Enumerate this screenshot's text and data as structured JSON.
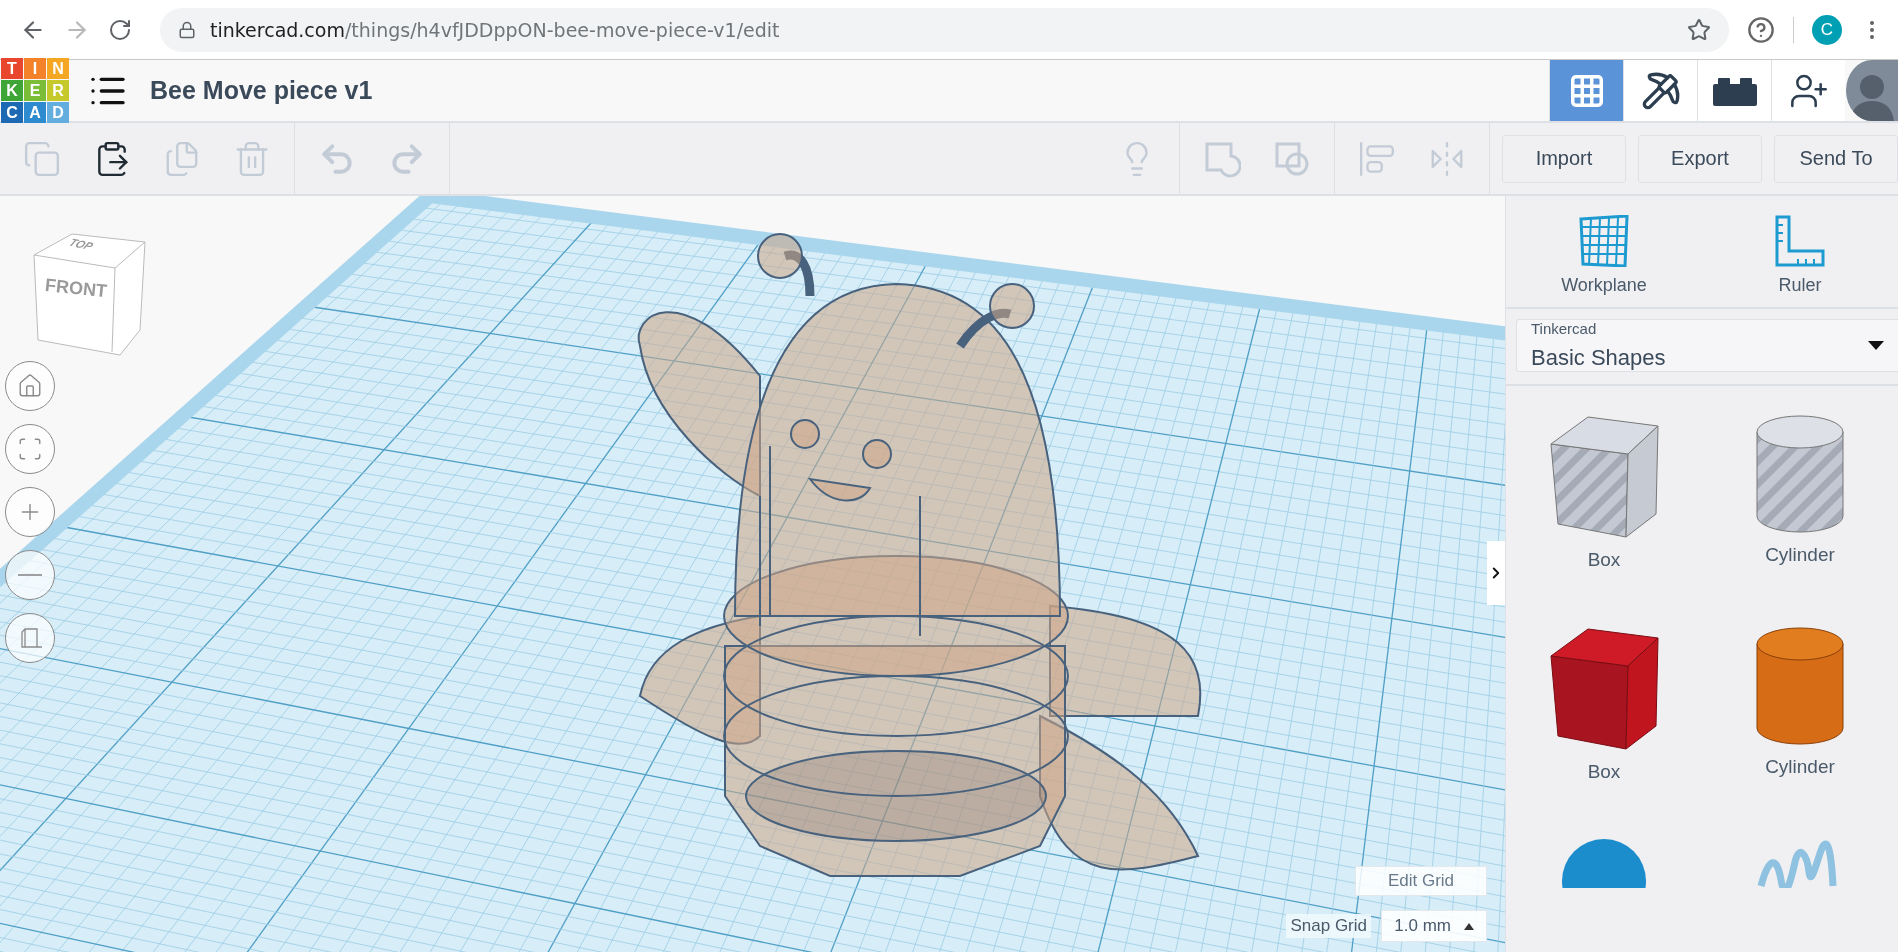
{
  "browser": {
    "back_disabled": false,
    "forward_disabled": true,
    "url_host": "tinkercad.com",
    "url_path": "/things/h4vfJDDppON-bee-move-piece-v1/edit",
    "profile_initial": "C"
  },
  "header": {
    "logo_letters": [
      {
        "letter": "T",
        "color": "#e8462d"
      },
      {
        "letter": "I",
        "color": "#f4822a"
      },
      {
        "letter": "N",
        "color": "#f5a623"
      },
      {
        "letter": "K",
        "color": "#3ea537"
      },
      {
        "letter": "E",
        "color": "#7cbd38"
      },
      {
        "letter": "R",
        "color": "#c6c92b"
      },
      {
        "letter": "C",
        "color": "#1d69b3"
      },
      {
        "letter": "A",
        "color": "#2e8bd0"
      },
      {
        "letter": "D",
        "color": "#63aedf"
      }
    ],
    "title": "Bee Move piece v1",
    "nav": [
      {
        "kind": "grid",
        "selected": true
      },
      {
        "kind": "pickaxe",
        "selected": false
      },
      {
        "kind": "bricks",
        "selected": false
      },
      {
        "kind": "add-user",
        "selected": false
      }
    ]
  },
  "toolbar": {
    "groups": [
      [
        {
          "kind": "copy",
          "disabled": true
        },
        {
          "kind": "paste",
          "disabled": false
        },
        {
          "kind": "duplicate",
          "disabled": true
        },
        {
          "kind": "delete",
          "disabled": true
        }
      ],
      [
        {
          "kind": "undo",
          "disabled": true
        },
        {
          "kind": "redo",
          "disabled": true
        }
      ],
      [
        {
          "kind": "note",
          "disabled": true
        }
      ],
      [
        {
          "kind": "group",
          "disabled": true
        },
        {
          "kind": "ungroup",
          "disabled": true
        }
      ],
      [
        {
          "kind": "align",
          "disabled": true
        },
        {
          "kind": "mirror",
          "disabled": true
        }
      ]
    ],
    "buttons": [
      "Import",
      "Export",
      "Send To"
    ]
  },
  "viewport": {
    "view_cube": {
      "top": "TOP",
      "front": "FRONT"
    },
    "nav_buttons": [
      {
        "kind": "home"
      },
      {
        "kind": "fit"
      },
      {
        "kind": "zoom-in"
      },
      {
        "kind": "zoom-out"
      },
      {
        "kind": "perspective"
      }
    ],
    "edit_grid": "Edit Grid",
    "snap_grid": {
      "label": "Snap Grid",
      "value": "1.0 mm"
    }
  },
  "panel": {
    "tools": [
      {
        "kind": "workplane",
        "label": "Workplane"
      },
      {
        "kind": "ruler",
        "label": "Ruler"
      }
    ],
    "library": {
      "source": "Tinkercad",
      "name": "Basic Shapes"
    },
    "shapes": [
      {
        "kind": "box-hole",
        "label": "Box"
      },
      {
        "kind": "cylinder-hole",
        "label": "Cylinder"
      },
      {
        "kind": "box",
        "label": "Box"
      },
      {
        "kind": "cylinder",
        "label": "Cylinder"
      },
      {
        "kind": "sphere"
      },
      {
        "kind": "scribble"
      }
    ]
  }
}
